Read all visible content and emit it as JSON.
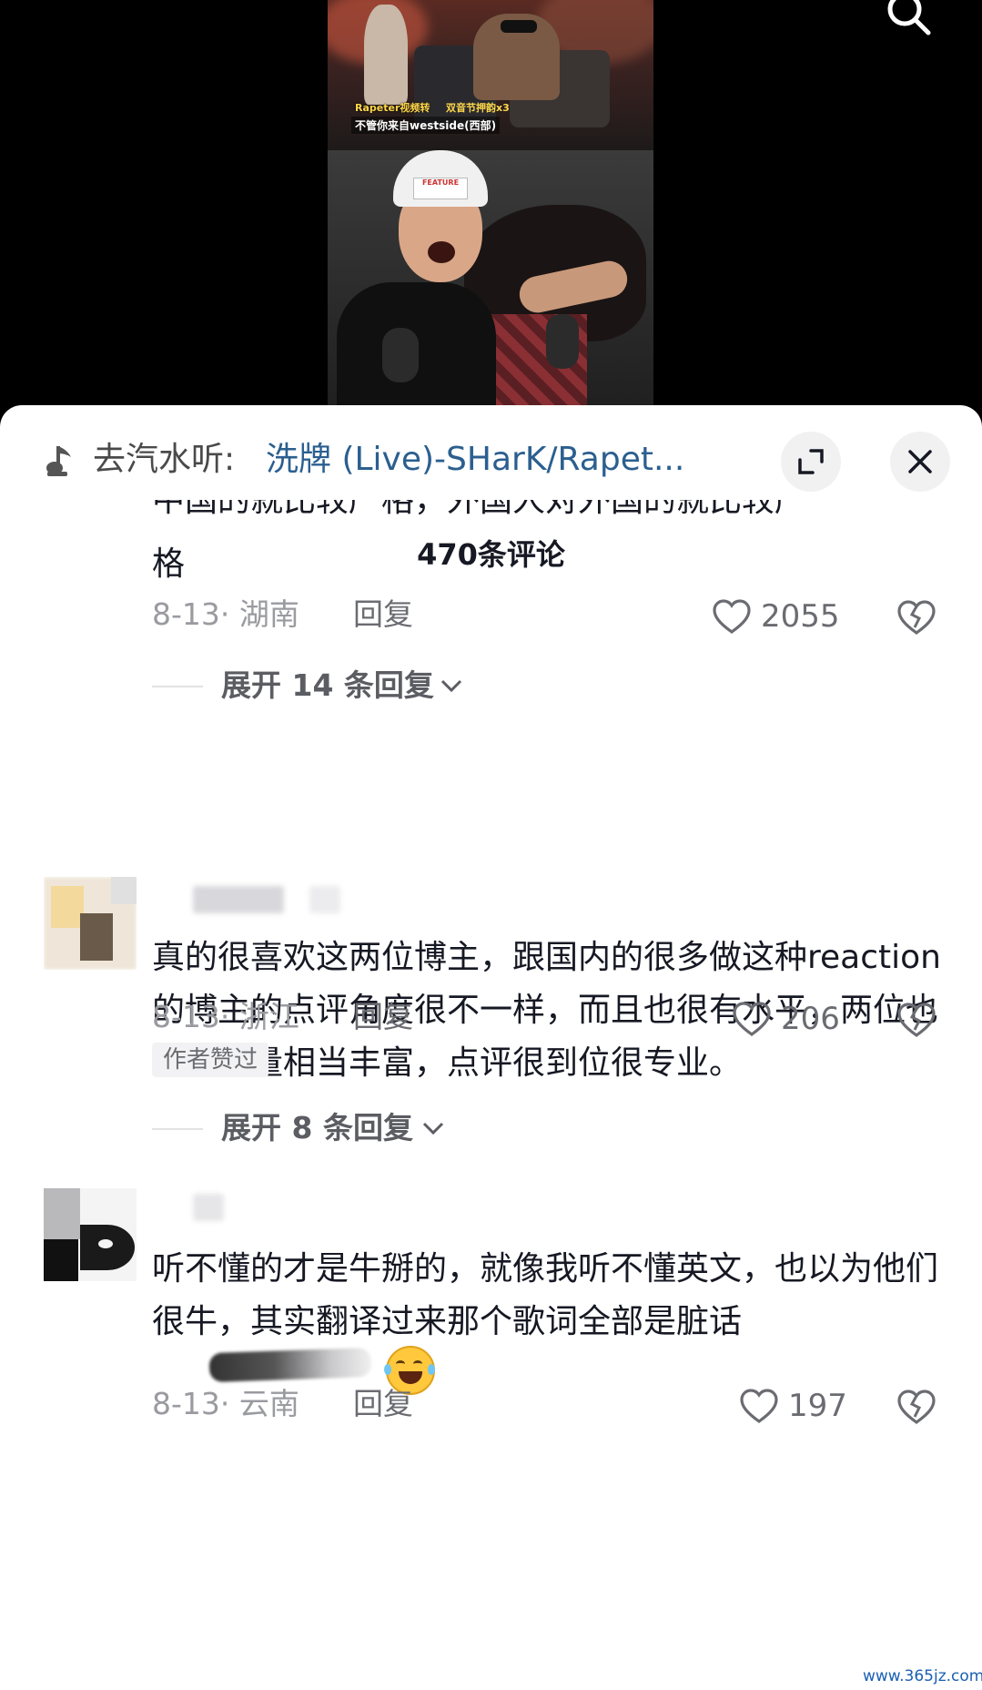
{
  "video": {
    "caption_1": "Rapeter视频转",
    "caption_2": "不管你来自westside(西部)",
    "caption_3": "双音节押韵x3",
    "hat_text": "FEATURE"
  },
  "music_bar": {
    "prefix": "去汽水听:",
    "title": "洗牌 (Live)-SHarK/Rapet..."
  },
  "comments_header": {
    "count_label": "470条评论"
  },
  "comments": [
    {
      "text_partial_line": "中国的就比较严格，外国人对外国的就比较严",
      "text": "格",
      "date_region": "8-13· 湖南",
      "reply_label": "回复",
      "likes": "2055",
      "expand_label": "展开 14 条回复"
    },
    {
      "text": "真的很喜欢这两位博主，跟国内的很多做这种reaction的博主的点评角度很不一样，而且也很有水平，两位也是阅曲量相当丰富，点评很到位很专业。",
      "date_region": "8-13· 浙江",
      "reply_label": "回复",
      "likes": "206",
      "badge": "作者赞过",
      "expand_label": "展开 8 条回复"
    },
    {
      "text": "听不懂的才是牛掰的，就像我听不懂英文，也以为他们很牛，其实翻译过来那个歌词全部是脏话",
      "date_region": "8-13· 云南",
      "reply_label": "回复",
      "likes": "197"
    }
  ],
  "watermark": "www.365jz.com",
  "colors": {
    "music_title": "#2b5f8f",
    "meta_gray": "#9a9ba0",
    "text_dark": "#161823"
  }
}
